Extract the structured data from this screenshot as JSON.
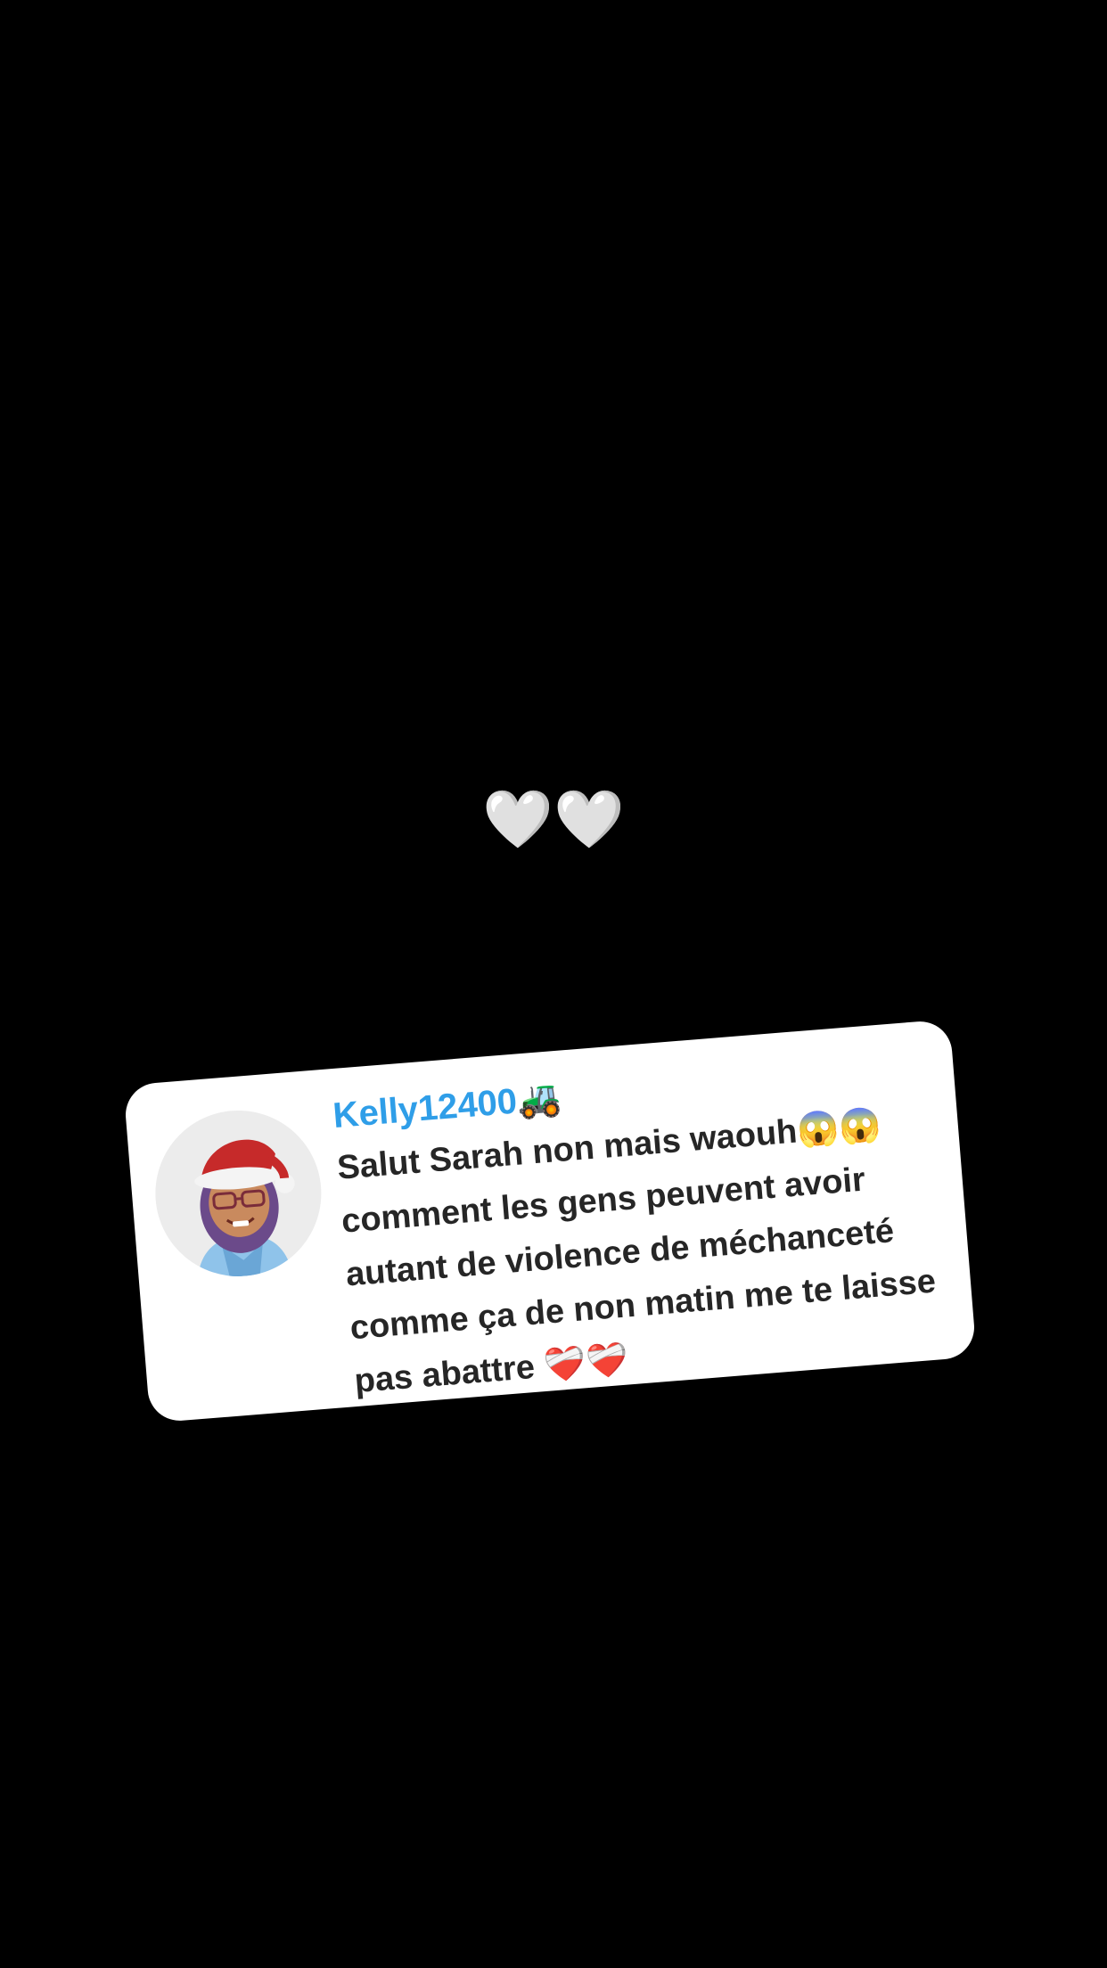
{
  "story": {
    "caption": "🤍🤍"
  },
  "comment": {
    "username": "Kelly12400🚜",
    "text": "Salut Sarah non mais waouh😱😱 comment les gens peuvent avoir autant de violence de méchanceté comme ça de non matin me te laisse pas abattre ❤️‍🩹❤️‍🩹",
    "avatar_icon": "memoji-santa-hat-avatar"
  },
  "colors": {
    "background": "#000000",
    "card": "#ffffff",
    "username": "#2f9ee8",
    "text": "#262626"
  }
}
